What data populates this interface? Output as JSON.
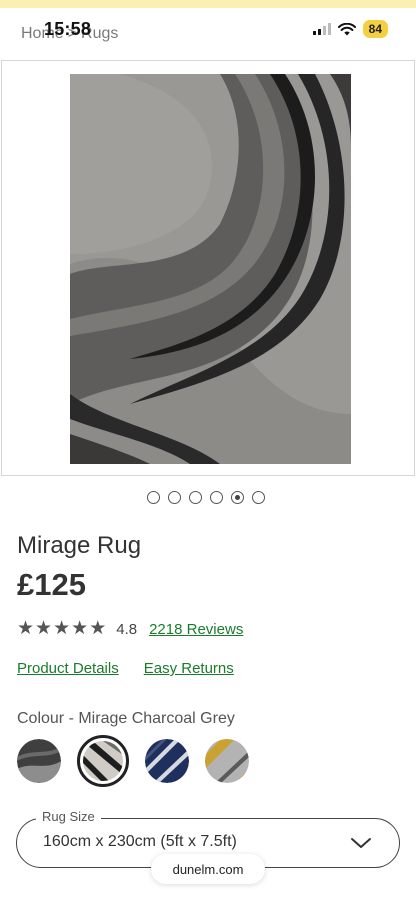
{
  "status_bar": {
    "time": "15:58",
    "battery": "84"
  },
  "breadcrumb": {
    "home": "Home",
    "separator": ">",
    "current": "Rugs"
  },
  "gallery": {
    "image_count": 6,
    "active_index": 5
  },
  "product": {
    "title": "Mirage Rug",
    "price": "£125",
    "rating": {
      "value": "4.8",
      "stars": 5,
      "reviews_label": "2218 Reviews"
    },
    "links": {
      "details": "Product Details",
      "returns": "Easy Returns"
    },
    "colour_label": "Colour - Mirage Charcoal Grey",
    "swatches": [
      {
        "name": "charcoal",
        "colors": [
          "#3f3f3f",
          "#8d8d8d"
        ]
      },
      {
        "name": "charcoal-grey",
        "colors": [
          "#d0ccc5",
          "#1e1e1e"
        ],
        "selected": true
      },
      {
        "name": "navy",
        "colors": [
          "#1f2f5e",
          "#d7d9e0"
        ]
      },
      {
        "name": "ochre",
        "colors": [
          "#c9a232",
          "#b3b3b3"
        ]
      }
    ],
    "size": {
      "legend": "Rug Size",
      "value": "160cm x 230cm (5ft x 7.5ft)"
    }
  },
  "browser": {
    "url": "dunelm.com"
  },
  "colors": {
    "link_green": "#1a7c2b",
    "status_strip": "#fbf0b2",
    "battery": "#f4d03f"
  }
}
